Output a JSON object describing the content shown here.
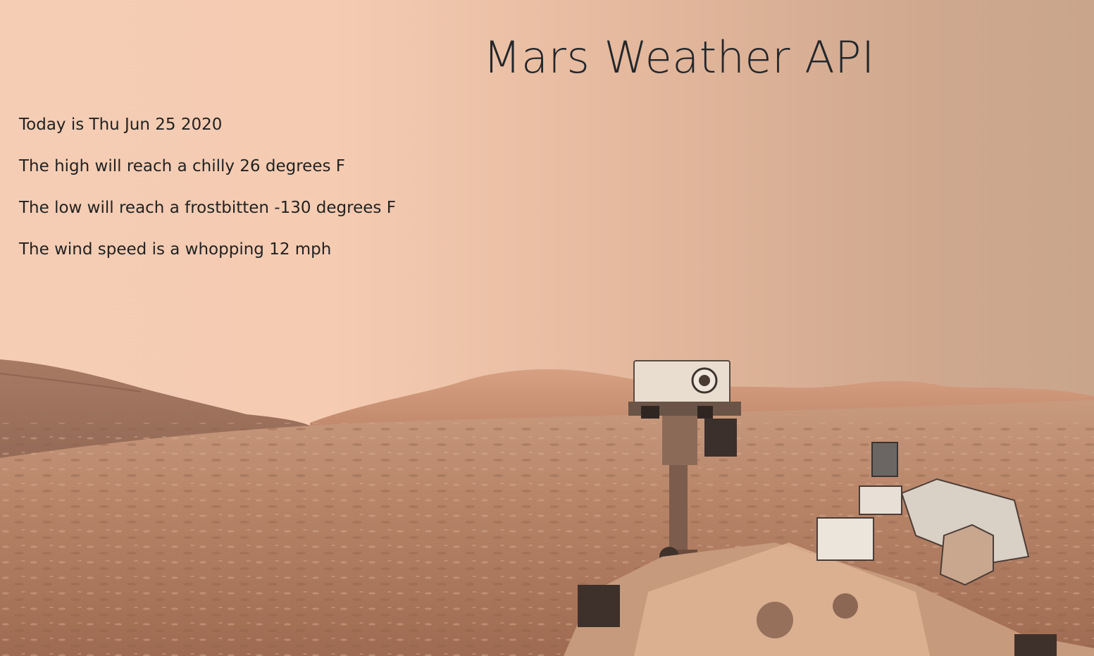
{
  "page": {
    "title": "Mars Weather API"
  },
  "weather": {
    "date_line": "Today is Thu Jun 25 2020",
    "high_line": "The high will reach a chilly 26 degrees F",
    "low_line": "The low will reach a frostbitten -130 degrees F",
    "wind_line": "The wind speed is a whopping 12 mph"
  },
  "background": {
    "image_subject": "curiosity-rover-selfie-mars-landscape",
    "sky_color": "#f4cdb4",
    "ground_color": "#b98566"
  }
}
